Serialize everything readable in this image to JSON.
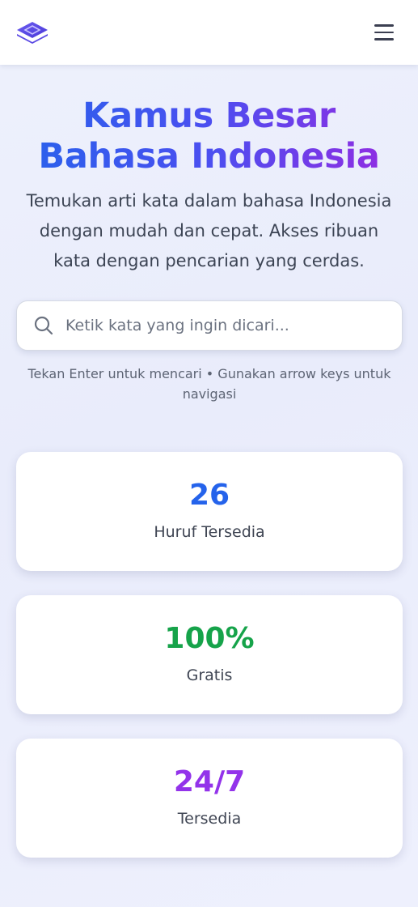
{
  "header": {
    "logo_icon": "layered-stack-logo-icon",
    "menu_icon": "hamburger-menu-icon"
  },
  "hero": {
    "title": "Kamus Besar Bahasa Indonesia",
    "subtitle": "Temukan arti kata dalam bahasa Indonesia dengan mudah dan cepat. Akses ribuan kata dengan pencarian yang cerdas."
  },
  "search": {
    "icon": "search-icon",
    "placeholder": "Ketik kata yang ingin dicari...",
    "value": "",
    "hint": "Tekan Enter untuk mencari • Gunakan arrow keys untuk navigasi"
  },
  "stats": [
    {
      "value": "26",
      "label": "Huruf Tersedia",
      "color": "#2563eb"
    },
    {
      "value": "100%",
      "label": "Gratis",
      "color": "#16a34a"
    },
    {
      "value": "24/7",
      "label": "Tersedia",
      "color": "#9333ea"
    }
  ],
  "colors": {
    "accent_blue": "#2563eb",
    "accent_purple": "#9333ea",
    "accent_green": "#16a34a"
  }
}
